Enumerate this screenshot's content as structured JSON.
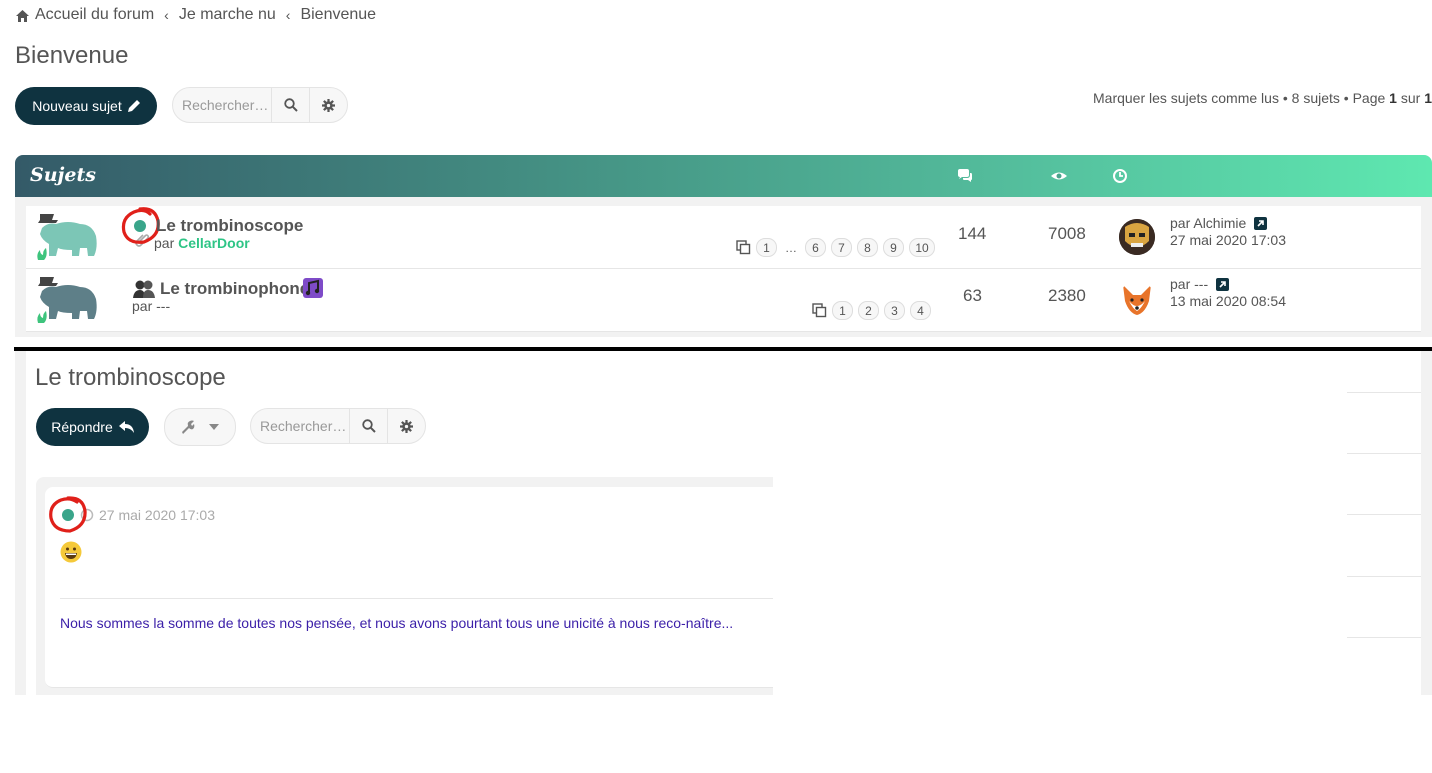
{
  "breadcrumb": {
    "items": [
      "Accueil du forum",
      "Je marche nu",
      "Bienvenue"
    ],
    "separator": "‹"
  },
  "forum": {
    "title": "Bienvenue",
    "new_topic_label": "Nouveau sujet",
    "search_placeholder": "Rechercher…",
    "pagination": {
      "mark_read": "Marquer les sujets comme lus",
      "topics_count": "8 sujets",
      "page_label": "Page",
      "page_current": "1",
      "page_of": "sur",
      "page_total": "1",
      "bullet": "•"
    },
    "header_label": "Sujets",
    "topics": [
      {
        "title": "Le trombinoscope",
        "by_label": "par",
        "author": "CellarDoor",
        "pages": [
          "1",
          "…",
          "6",
          "7",
          "8",
          "9",
          "10"
        ],
        "replies": "144",
        "views": "7008",
        "last_by": "par Alchimie",
        "last_date": "27 mai 2020 17:03"
      },
      {
        "title": "Le trombinophone",
        "byline": "par ---",
        "pages": [
          "1",
          "2",
          "3",
          "4"
        ],
        "replies": "63",
        "views": "2380",
        "last_by": "par ---",
        "last_date": "13 mai 2020 08:54"
      }
    ]
  },
  "topic_view": {
    "title": "Le trombinoscope",
    "reply_label": "Répondre",
    "search_placeholder": "Rechercher…",
    "post": {
      "date": "27 mai 2020 17:03",
      "text": "Nous sommes la somme de toutes nos pensée, et nous avons pourtant tous une unicité à nous reco-naître..."
    }
  },
  "colors": {
    "dark_button": "#0f3340",
    "header_gradient_start": "#345a68",
    "header_gradient_end": "#5ee8b0",
    "author_green": "#2ec586",
    "status_dot": "#3aa58a",
    "highlight_circle": "#e0201a",
    "post_text": "#3b1fa8"
  }
}
